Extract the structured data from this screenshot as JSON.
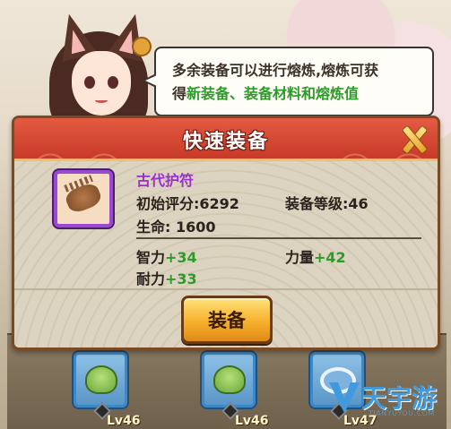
{
  "dialogue": {
    "line1": "多余装备可以进行熔炼,熔炼可获",
    "line2_prefix": "得",
    "line2_highlight": "新装备、装备材料和熔炼值"
  },
  "dialog": {
    "title": "快速装备",
    "item": {
      "name": "古代护符",
      "initial_score_label": "初始评分:",
      "initial_score": "6292",
      "equip_level_label": "装备等级:",
      "equip_level": "46",
      "hp_label": "生命: ",
      "hp": "1600",
      "int_label": "智力",
      "int_bonus": "+34",
      "str_label": "力量",
      "str_bonus": "+42",
      "sta_label": "耐力",
      "sta_bonus": "+33"
    },
    "equip_button": "装备"
  },
  "background_slots": [
    {
      "level": "Lv46"
    },
    {
      "level": "Lv46"
    },
    {
      "level": "Lv47"
    }
  ],
  "watermark": {
    "text": "天宇游",
    "url": "TIANYUYOU.COM"
  },
  "colors": {
    "header_red": "#d34a34",
    "item_purple": "#9a2ed0",
    "bonus_green": "#2d9a2a",
    "button_gold": "#f6b02c"
  }
}
